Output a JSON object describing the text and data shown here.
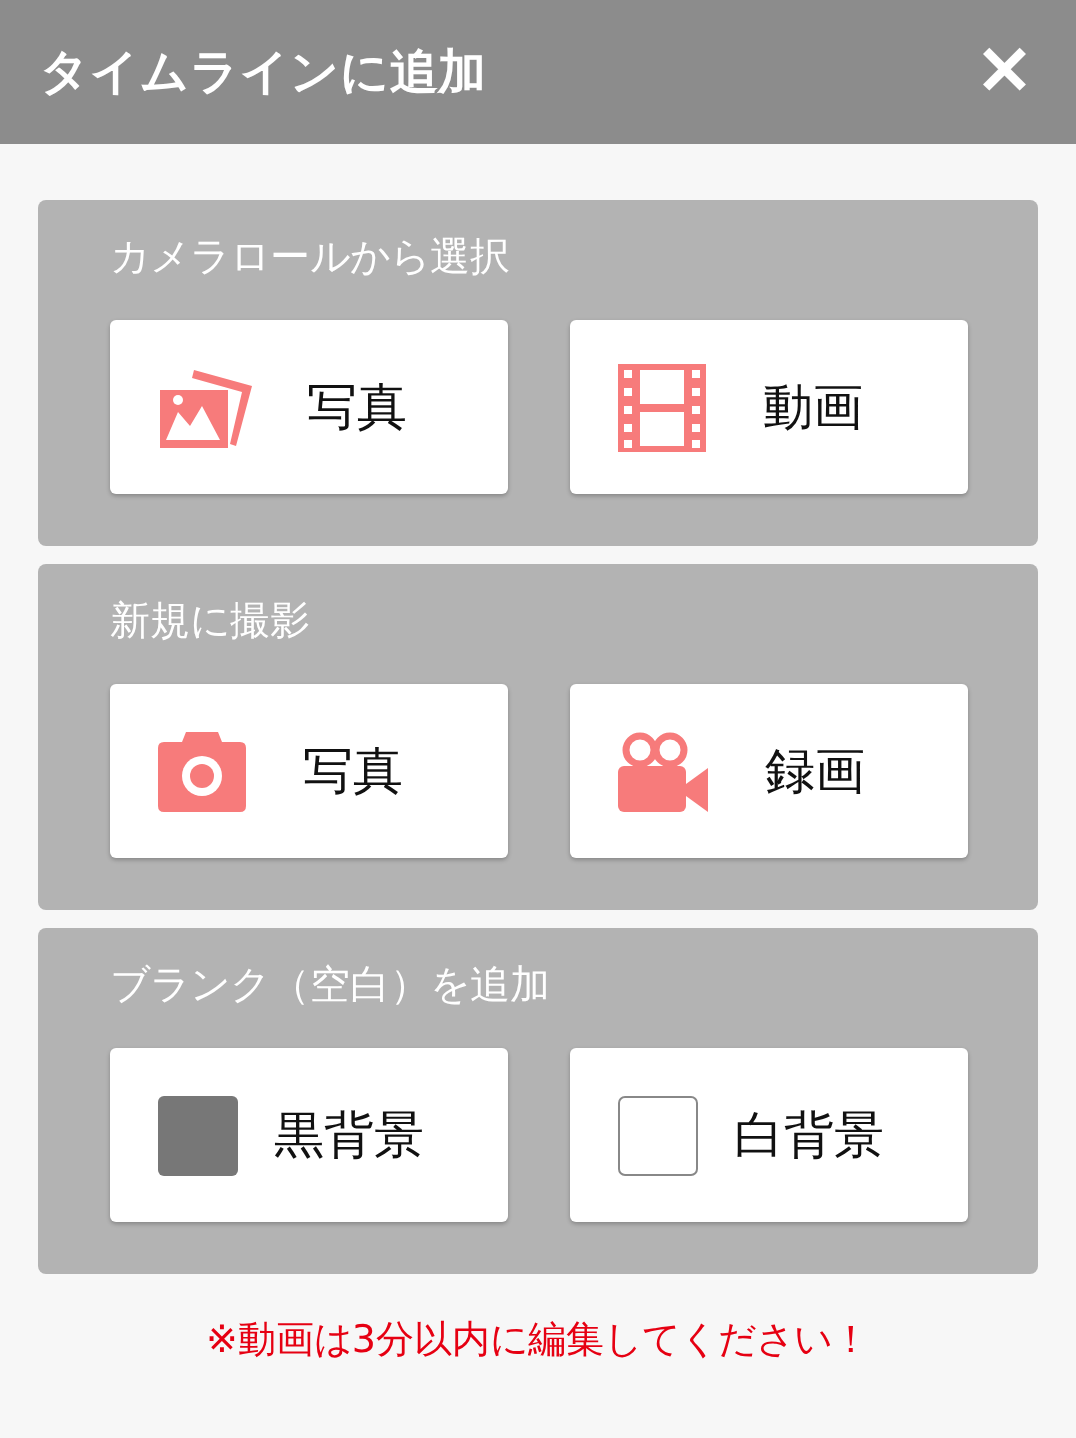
{
  "header": {
    "title": "タイムラインに追加",
    "close": "✕"
  },
  "sections": [
    {
      "title": "カメラロールから選択",
      "buttons": [
        {
          "kind": "photos",
          "label": "写真"
        },
        {
          "kind": "film",
          "label": "動画"
        }
      ]
    },
    {
      "title": "新規に撮影",
      "buttons": [
        {
          "kind": "camera",
          "label": "写真"
        },
        {
          "kind": "video",
          "label": "録画"
        }
      ]
    },
    {
      "title": "ブランク（空白）を追加",
      "buttons": [
        {
          "kind": "black",
          "label": "黒背景"
        },
        {
          "kind": "white",
          "label": "白背景"
        }
      ]
    }
  ],
  "note": "※動画は3分以内に編集してください！"
}
